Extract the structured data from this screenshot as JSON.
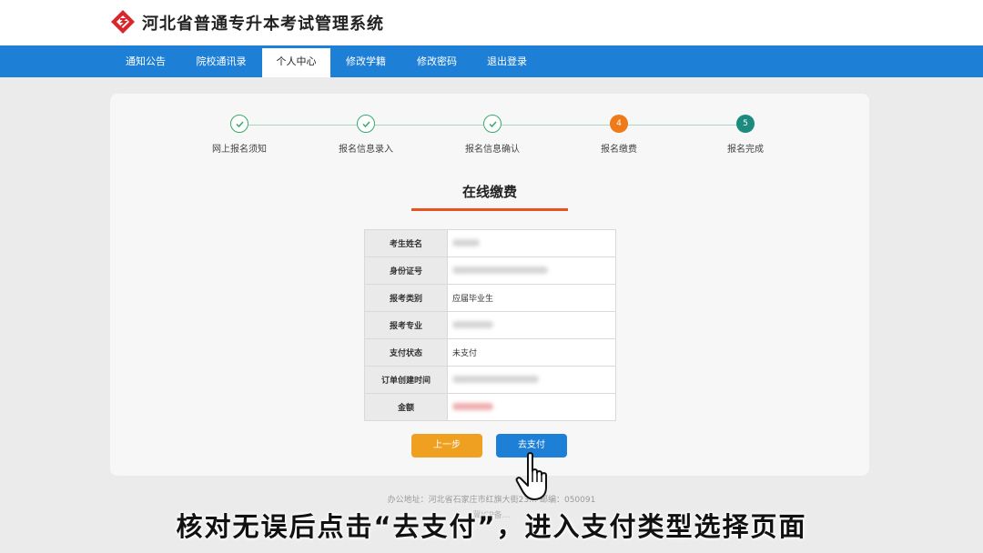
{
  "header": {
    "title": "河北省普通专升本考试管理系统",
    "logo_icon": "diamond-logo-icon"
  },
  "nav": {
    "items": [
      "通知公告",
      "院校通讯录",
      "个人中心",
      "修改学籍",
      "修改密码",
      "退出登录"
    ],
    "active": "个人中心"
  },
  "steps": [
    {
      "label": "网上报名须知",
      "state": "done"
    },
    {
      "label": "报名信息录入",
      "state": "done"
    },
    {
      "label": "报名信息确认",
      "state": "done"
    },
    {
      "label": "报名缴费",
      "state": "current",
      "number": "4"
    },
    {
      "label": "报名完成",
      "state": "pending",
      "number": "5"
    }
  ],
  "section_title": "在线缴费",
  "table": {
    "rows": [
      {
        "label": "考生姓名",
        "value": ""
      },
      {
        "label": "身份证号",
        "value": ""
      },
      {
        "label": "报考类别",
        "value": "应届毕业生"
      },
      {
        "label": "报考专业",
        "value": ""
      },
      {
        "label": "支付状态",
        "value": "未支付"
      },
      {
        "label": "订单创建时间",
        "value": ""
      },
      {
        "label": "金额",
        "value": ""
      }
    ]
  },
  "buttons": {
    "prev": "上一步",
    "pay": "去支付"
  },
  "footer": {
    "address": "办公地址：河北省石家庄市红旗大街23…  邮编：050091",
    "icp": "冀ICP备…"
  },
  "caption": "核对无误后点击“去支付”，进入支付类型选择页面",
  "colors": {
    "nav_blue": "#1e7fd6",
    "done_green": "#3aa86d",
    "current_orange": "#ef7a1a",
    "next_teal": "#1c8a7f",
    "title_underline": "#e8531e",
    "prev_button": "#f0a020"
  }
}
